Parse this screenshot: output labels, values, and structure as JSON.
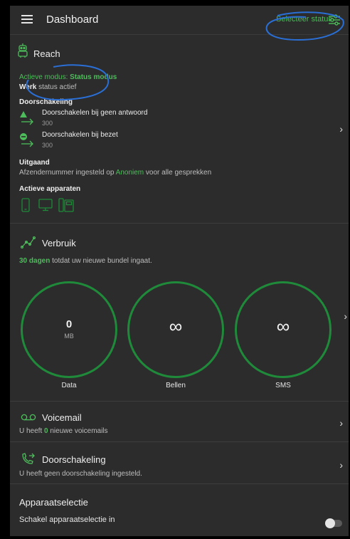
{
  "appbar": {
    "title": "Dashboard",
    "status_button": "Selecteer status"
  },
  "reach": {
    "title": "Reach",
    "mode_label": "Actieve modus:",
    "mode_value": "Status modus",
    "status_bold": "Werk",
    "status_rest": "status actief",
    "forwarding_heading": "Doorschakeling",
    "forward_items": [
      {
        "label": "Doorschakelen bij geen antwoord",
        "value": "300"
      },
      {
        "label": "Doorschakelen bij bezet",
        "value": "300"
      }
    ],
    "outgoing_heading": "Uitgaand",
    "outgoing_pre": "Afzendernummer ingesteld op",
    "outgoing_value": "Anoniem",
    "outgoing_post": "voor alle gesprekken",
    "devices_heading": "Actieve apparaten"
  },
  "usage": {
    "title": "Verbruik",
    "days": "30 dagen",
    "days_rest": "totdat uw nieuwe bundel ingaat.",
    "meters": [
      {
        "value": "0",
        "unit": "MB",
        "label": "Data"
      },
      {
        "value": "∞",
        "label": "Bellen"
      },
      {
        "value": "∞",
        "label": "SMS"
      }
    ]
  },
  "voicemail": {
    "title": "Voicemail",
    "pre": "U heeft",
    "count": "0",
    "post": "nieuwe voicemails"
  },
  "forwarding": {
    "title": "Doorschakeling",
    "subtitle": "U heeft geen doorschakeling ingesteld."
  },
  "device_selection": {
    "title": "Apparaatselectie",
    "toggle_label": "Schakel apparaatselectie in"
  },
  "colors": {
    "accent": "#4cbd5a",
    "ring": "#1f8a3a",
    "annotation": "#2a6fd6",
    "background": "#2c2c2c"
  },
  "icons": [
    "menu-icon",
    "filter-sliders-icon",
    "robot-icon",
    "warning-forward-icon",
    "busy-forward-icon",
    "phone-device-icon",
    "desktop-device-icon",
    "deskphone-device-icon",
    "usage-graph-icon",
    "voicemail-icon",
    "call-forward-icon",
    "chevron-right-icon"
  ]
}
